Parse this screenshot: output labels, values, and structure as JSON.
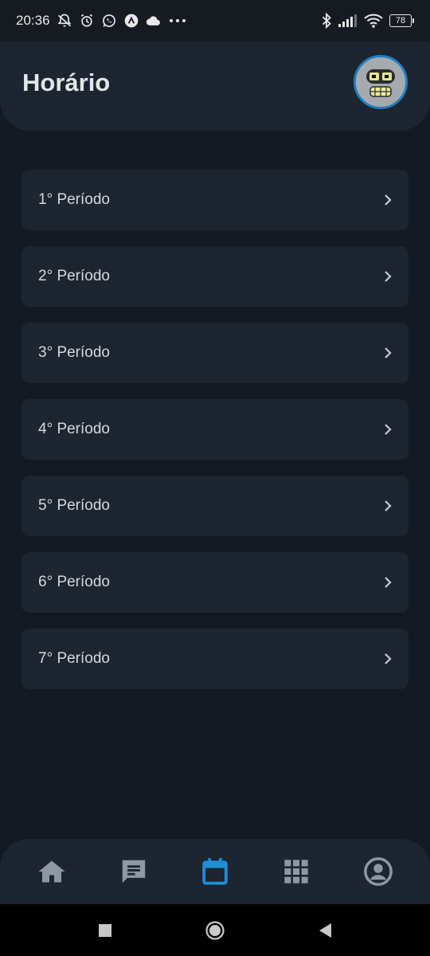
{
  "status_bar": {
    "time": "20:36",
    "battery": "78",
    "icons": [
      "notifications-off-icon",
      "alarm-icon",
      "whatsapp-icon",
      "app-icon",
      "cloud-icon",
      "more-icon",
      "bluetooth-icon",
      "signal-icon",
      "wifi-icon",
      "battery-icon"
    ]
  },
  "header": {
    "title": "Horário"
  },
  "periods": [
    {
      "label": "1° Período"
    },
    {
      "label": "2° Período"
    },
    {
      "label": "3° Período"
    },
    {
      "label": "4° Período"
    },
    {
      "label": "5° Período"
    },
    {
      "label": "6° Período"
    },
    {
      "label": "7° Período"
    }
  ],
  "bottom_nav": {
    "items": [
      "home-icon",
      "messages-icon",
      "calendar-icon",
      "apps-grid-icon",
      "profile-icon"
    ],
    "active": "calendar-icon",
    "active_color": "#1f8fd6",
    "inactive_color": "#8e98a4"
  },
  "colors": {
    "background": "#131a22",
    "card": "#1d2530",
    "accent": "#1f8fd6"
  }
}
